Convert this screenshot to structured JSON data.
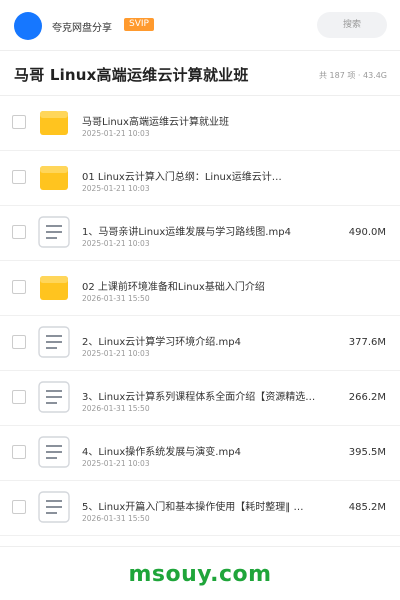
{
  "header": {
    "app_name": "夸克网盘分享",
    "badge": "SVIP",
    "search_placeholder": "搜索"
  },
  "folder": {
    "title": "马哥 Linux高端运维云计算就业班",
    "count_size": "共 187 项 · 43.4G"
  },
  "items": [
    {
      "type": "folder",
      "name": "马哥Linux高端运维云计算就业班",
      "date": "2025-01-21 10:03",
      "size": ""
    },
    {
      "type": "folder",
      "name": "01 Linux云计算入门总纲：Linux运维云计…",
      "date": "2025-01-21 10:03",
      "size": ""
    },
    {
      "type": "file",
      "name": "1、马哥亲讲Linux运维发展与学习路线图.mp4",
      "date": "2025-01-21 10:03",
      "size": "490.0M"
    },
    {
      "type": "folder",
      "name": "02 上课前环境准备和Linux基础入门介绍",
      "date": "2026-01-31 15:50",
      "size": ""
    },
    {
      "type": "file",
      "name": "2、Linux云计算学习环境介绍.mp4",
      "date": "2025-01-21 10:03",
      "size": "377.6M"
    },
    {
      "type": "file",
      "name": "3、Linux云计算系列课程体系全面介绍【资源精选…",
      "date": "2026-01-31 15:50",
      "size": "266.2M"
    },
    {
      "type": "file",
      "name": "4、Linux操作系统发展与演变.mp4",
      "date": "2025-01-21 10:03",
      "size": "395.5M"
    },
    {
      "type": "file",
      "name": "5、Linux开篇入门和基本操作使用【耗时整理‖ …",
      "date": "2026-01-31 15:50",
      "size": "485.2M"
    }
  ],
  "icons": {
    "folder": "folder-icon",
    "file": "document-icon"
  },
  "colors": {
    "accent": "#1677ff",
    "svip": "#ff9a2e",
    "folder": "#ffc41f",
    "brand_green": "#1fa53a"
  },
  "watermark": "msouy.com"
}
